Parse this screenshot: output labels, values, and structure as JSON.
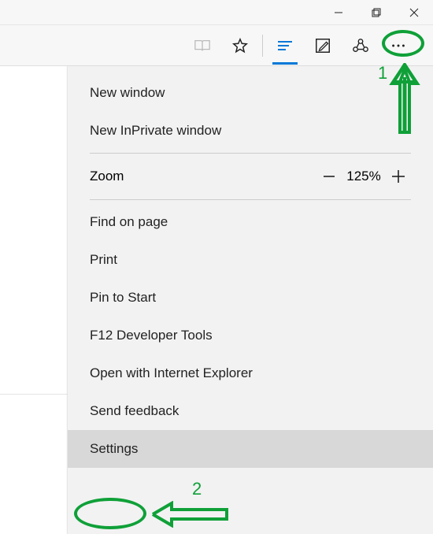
{
  "titlebar": {
    "minimize": "−",
    "maximize": "❐",
    "close": "✕"
  },
  "toolbar": {
    "reading_icon": "reading-view-icon",
    "favorites_icon": "star-icon",
    "hub_icon": "hub-icon",
    "webnote_icon": "webnote-icon",
    "share_icon": "share-icon",
    "more_icon": "more-icon"
  },
  "menu": {
    "new_window": "New window",
    "new_inprivate": "New InPrivate window",
    "zoom_label": "Zoom",
    "zoom_value": "125%",
    "find": "Find on page",
    "print": "Print",
    "pin": "Pin to Start",
    "devtools": "F12 Developer Tools",
    "open_ie": "Open with Internet Explorer",
    "feedback": "Send feedback",
    "settings": "Settings"
  },
  "annotations": {
    "label1": "1",
    "label2": "2"
  }
}
